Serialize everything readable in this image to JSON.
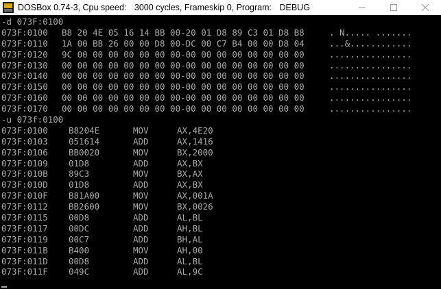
{
  "window": {
    "title_parts": [
      "DOSBox 0.74-3, Cpu speed:",
      "3000 cycles, Frameskip  0, Program:",
      "DEBUG"
    ],
    "icon": "dosbox-app-icon",
    "controls": [
      "minimize-icon",
      "maximize-icon",
      "close-icon"
    ]
  },
  "colors": {
    "console_bg": "#000000",
    "console_text": "#aaaaaa",
    "titlebar_bg": "#ffffff"
  },
  "console": {
    "dump_command": "-d 073F:0100",
    "dump_rows": [
      {
        "addr": "073F:0100",
        "hex": "B8 20 4E 05 16 14 BB 00-20 01 D8 89 C3 01 D8 B8",
        "ascii": ". N..... ......."
      },
      {
        "addr": "073F:0110",
        "hex": "1A 00 BB 26 00 00 D8 00-DC 00 C7 B4 00 00 D8 04",
        "ascii": "...&............"
      },
      {
        "addr": "073F:0120",
        "hex": "9C 00 00 00 00 00 00 00-00 00 00 00 00 00 00 00",
        "ascii": "................"
      },
      {
        "addr": "073F:0130",
        "hex": "00 00 00 00 00 00 00 00-00 00 00 00 00 00 00 00",
        "ascii": "................"
      },
      {
        "addr": "073F:0140",
        "hex": "00 00 00 00 00 00 00 00-00 00 00 00 00 00 00 00",
        "ascii": "................"
      },
      {
        "addr": "073F:0150",
        "hex": "00 00 00 00 00 00 00 00-00 00 00 00 00 00 00 00",
        "ascii": "................"
      },
      {
        "addr": "073F:0160",
        "hex": "00 00 00 00 00 00 00 00-00 00 00 00 00 00 00 00",
        "ascii": "................"
      },
      {
        "addr": "073F:0170",
        "hex": "00 00 00 00 00 00 00 00-00 00 00 00 00 00 00 00",
        "ascii": "................"
      }
    ],
    "unasm_command": "-u 073f:0100",
    "disasm_rows": [
      {
        "addr": "073F:0100",
        "code": "B8204E",
        "mnem": "MOV",
        "ops": "AX,4E20"
      },
      {
        "addr": "073F:0103",
        "code": "051614",
        "mnem": "ADD",
        "ops": "AX,1416"
      },
      {
        "addr": "073F:0106",
        "code": "BB0020",
        "mnem": "MOV",
        "ops": "BX,2000"
      },
      {
        "addr": "073F:0109",
        "code": "01D8",
        "mnem": "ADD",
        "ops": "AX,BX"
      },
      {
        "addr": "073F:010B",
        "code": "89C3",
        "mnem": "MOV",
        "ops": "BX,AX"
      },
      {
        "addr": "073F:010D",
        "code": "01D8",
        "mnem": "ADD",
        "ops": "AX,BX"
      },
      {
        "addr": "073F:010F",
        "code": "B81A00",
        "mnem": "MOV",
        "ops": "AX,001A"
      },
      {
        "addr": "073F:0112",
        "code": "BB2600",
        "mnem": "MOV",
        "ops": "BX,0026"
      },
      {
        "addr": "073F:0115",
        "code": "00D8",
        "mnem": "ADD",
        "ops": "AL,BL"
      },
      {
        "addr": "073F:0117",
        "code": "00DC",
        "mnem": "ADD",
        "ops": "AH,BL"
      },
      {
        "addr": "073F:0119",
        "code": "00C7",
        "mnem": "ADD",
        "ops": "BH,AL"
      },
      {
        "addr": "073F:011B",
        "code": "B400",
        "mnem": "MOV",
        "ops": "AH,00"
      },
      {
        "addr": "073F:011D",
        "code": "00D8",
        "mnem": "ADD",
        "ops": "AL,BL"
      },
      {
        "addr": "073F:011F",
        "code": "049C",
        "mnem": "ADD",
        "ops": "AL,9C"
      }
    ]
  }
}
